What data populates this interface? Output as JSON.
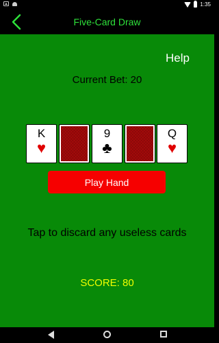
{
  "status_bar": {
    "time": "1:35",
    "left_icons": [
      "image-icon",
      "android-icon"
    ],
    "right_icons": [
      "wifi-icon",
      "battery-icon"
    ]
  },
  "app_bar": {
    "title": "Five-Card Draw",
    "back_icon": "chevron-left-icon",
    "title_color": "#2ee03a"
  },
  "game": {
    "help_label": "Help",
    "current_bet": "Current Bet: 20",
    "cards": [
      {
        "state": "face",
        "rank": "K",
        "suit": "♥",
        "suit_color": "red"
      },
      {
        "state": "back"
      },
      {
        "state": "face",
        "rank": "9",
        "suit": "♣",
        "suit_color": "black"
      },
      {
        "state": "back"
      },
      {
        "state": "face",
        "rank": "Q",
        "suit": "♥",
        "suit_color": "red"
      }
    ],
    "play_button_label": "Play Hand",
    "instruction": "Tap to discard any useless cards",
    "score": "SCORE: 80"
  },
  "colors": {
    "table_green": "#088a08",
    "button_red": "#f60000",
    "score_yellow": "#f0ff00",
    "card_back_red": "#a50a0a"
  },
  "nav_bar": {
    "buttons": [
      "back-triangle-icon",
      "home-circle-icon",
      "recent-square-icon"
    ]
  }
}
